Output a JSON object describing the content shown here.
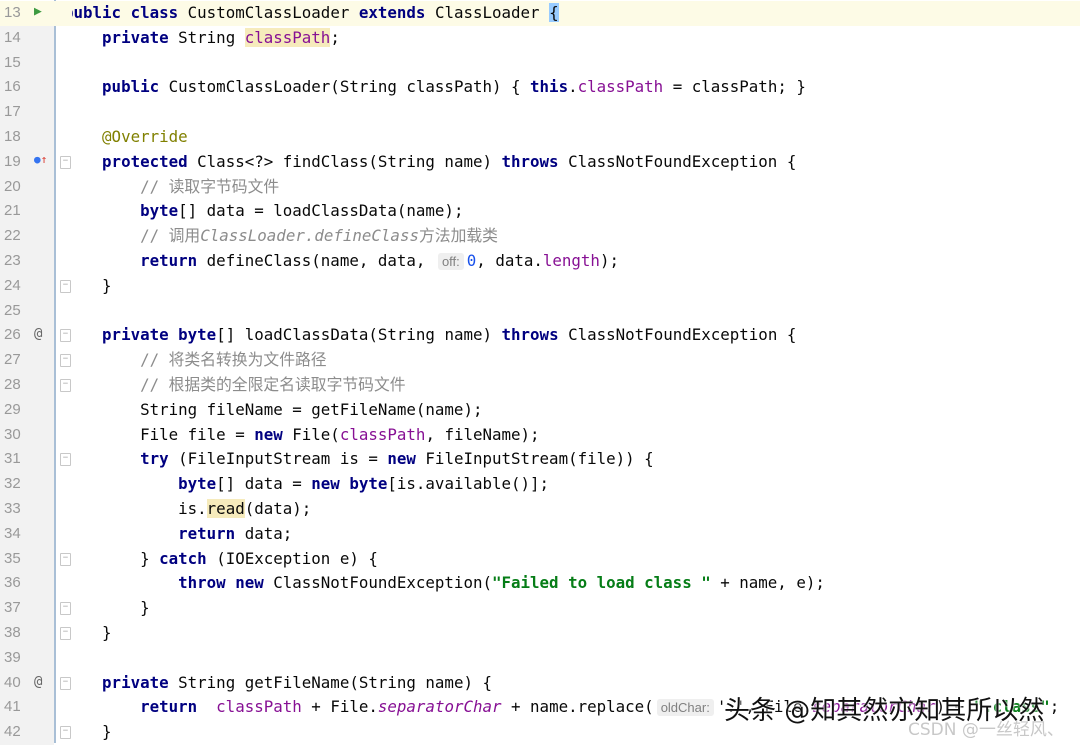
{
  "editor": {
    "current_line": 13,
    "lines": [
      {
        "n": "13",
        "icon": "run",
        "fold": "",
        "tokens": [
          [
            "public ",
            "kw"
          ],
          [
            "class ",
            "kw"
          ],
          [
            "CustomClassLoader ",
            ""
          ],
          [
            "extends ",
            "kw"
          ],
          [
            "ClassLoader ",
            ""
          ],
          [
            "{",
            "brace"
          ]
        ]
      },
      {
        "n": "14",
        "icon": "",
        "fold": "",
        "tokens": [
          [
            "    private ",
            "kw"
          ],
          [
            "String ",
            ""
          ],
          [
            "classPath",
            "fld hl"
          ],
          [
            ";",
            ""
          ]
        ]
      },
      {
        "n": "15",
        "icon": "",
        "fold": "",
        "tokens": []
      },
      {
        "n": "16",
        "icon": "",
        "fold": "",
        "tokens": [
          [
            "    public ",
            "kw"
          ],
          [
            "CustomClassLoader(String classPath) { ",
            ""
          ],
          [
            "this",
            "kw"
          ],
          [
            ".",
            ""
          ],
          [
            "classPath",
            "fld"
          ],
          [
            " = classPath; }",
            ""
          ]
        ]
      },
      {
        "n": "17",
        "icon": "",
        "fold": "",
        "tokens": []
      },
      {
        "n": "18",
        "icon": "",
        "fold": "",
        "tokens": [
          [
            "    @Override",
            "ann"
          ]
        ]
      },
      {
        "n": "19",
        "icon": "override",
        "fold": "open",
        "tokens": [
          [
            "    protected ",
            "kw"
          ],
          [
            "Class<?> findClass(String name) ",
            ""
          ],
          [
            "throws ",
            "kw"
          ],
          [
            "ClassNotFoundException {",
            ""
          ]
        ]
      },
      {
        "n": "20",
        "icon": "",
        "fold": "",
        "tokens": [
          [
            "        // 读取字节码文件",
            "cmt"
          ]
        ]
      },
      {
        "n": "21",
        "icon": "",
        "fold": "",
        "tokens": [
          [
            "        byte",
            "kw"
          ],
          [
            "[] data = loadClassData(name);",
            ""
          ]
        ]
      },
      {
        "n": "22",
        "icon": "",
        "fold": "",
        "tokens": [
          [
            "        // 调用",
            "cmt"
          ],
          [
            "ClassLoader.defineClass",
            "cmti"
          ],
          [
            "方法加载类",
            "cmt"
          ]
        ]
      },
      {
        "n": "23",
        "icon": "",
        "fold": "",
        "tokens": [
          [
            "        return ",
            "kw"
          ],
          [
            "defineClass(name, data, ",
            ""
          ],
          [
            "off:",
            "hint"
          ],
          [
            "0",
            "num"
          ],
          [
            ", data.",
            ""
          ],
          [
            "length",
            "fld"
          ],
          [
            ");",
            ""
          ]
        ]
      },
      {
        "n": "24",
        "icon": "",
        "fold": "close",
        "tokens": [
          [
            "    }",
            ""
          ]
        ]
      },
      {
        "n": "25",
        "icon": "",
        "fold": "",
        "tokens": []
      },
      {
        "n": "26",
        "icon": "at",
        "fold": "open",
        "tokens": [
          [
            "    private ",
            "kw"
          ],
          [
            "byte",
            "kw"
          ],
          [
            "[] loadClassData(String name) ",
            ""
          ],
          [
            "throws ",
            "kw"
          ],
          [
            "ClassNotFoundException {",
            ""
          ]
        ]
      },
      {
        "n": "27",
        "icon": "",
        "fold": "open",
        "tokens": [
          [
            "        // 将类名转换为文件路径",
            "cmt"
          ]
        ]
      },
      {
        "n": "28",
        "icon": "",
        "fold": "close",
        "tokens": [
          [
            "        // 根据类的全限定名读取字节码文件",
            "cmt"
          ]
        ]
      },
      {
        "n": "29",
        "icon": "",
        "fold": "",
        "tokens": [
          [
            "        String fileName = getFileName(name);",
            ""
          ]
        ]
      },
      {
        "n": "30",
        "icon": "",
        "fold": "",
        "tokens": [
          [
            "        File file = ",
            ""
          ],
          [
            "new ",
            "kw"
          ],
          [
            "File(",
            ""
          ],
          [
            "classPath",
            "fld"
          ],
          [
            ", fileName);",
            ""
          ]
        ]
      },
      {
        "n": "31",
        "icon": "",
        "fold": "open",
        "tokens": [
          [
            "        try ",
            "kw"
          ],
          [
            "(FileInputStream is = ",
            ""
          ],
          [
            "new ",
            "kw"
          ],
          [
            "FileInputStream(file)) {",
            ""
          ]
        ]
      },
      {
        "n": "32",
        "icon": "",
        "fold": "",
        "tokens": [
          [
            "            byte",
            "kw"
          ],
          [
            "[] data = ",
            ""
          ],
          [
            "new ",
            "kw"
          ],
          [
            "byte",
            "kw"
          ],
          [
            "[is.available()];",
            ""
          ]
        ]
      },
      {
        "n": "33",
        "icon": "",
        "fold": "",
        "tokens": [
          [
            "            is.",
            ""
          ],
          [
            "read",
            "hl"
          ],
          [
            "(data);",
            ""
          ]
        ]
      },
      {
        "n": "34",
        "icon": "",
        "fold": "",
        "tokens": [
          [
            "            return ",
            "kw"
          ],
          [
            "data;",
            ""
          ]
        ]
      },
      {
        "n": "35",
        "icon": "",
        "fold": "close",
        "tokens": [
          [
            "        } ",
            ""
          ],
          [
            "catch ",
            "kw"
          ],
          [
            "(IOException e) {",
            ""
          ]
        ]
      },
      {
        "n": "36",
        "icon": "",
        "fold": "",
        "tokens": [
          [
            "            throw new ",
            "kw"
          ],
          [
            "ClassNotFoundException(",
            ""
          ],
          [
            "\"Failed to load class \"",
            "str"
          ],
          [
            " + name, e);",
            ""
          ]
        ]
      },
      {
        "n": "37",
        "icon": "",
        "fold": "close",
        "tokens": [
          [
            "        }",
            ""
          ]
        ]
      },
      {
        "n": "38",
        "icon": "",
        "fold": "close",
        "tokens": [
          [
            "    }",
            ""
          ]
        ]
      },
      {
        "n": "39",
        "icon": "",
        "fold": "",
        "tokens": []
      },
      {
        "n": "40",
        "icon": "at",
        "fold": "open",
        "tokens": [
          [
            "    private ",
            "kw"
          ],
          [
            "String getFileName(String name) {",
            ""
          ]
        ]
      },
      {
        "n": "41",
        "icon": "",
        "fold": "",
        "tokens": [
          [
            "        return  ",
            "kw"
          ],
          [
            "classPath",
            "fld"
          ],
          [
            " + File.",
            ""
          ],
          [
            "separatorChar",
            "sfld"
          ],
          [
            " + name.replace(",
            ""
          ],
          [
            "oldChar:",
            "hint"
          ],
          [
            "'.', File.",
            ""
          ],
          [
            "separatorChar",
            "sfld"
          ],
          [
            ") + ",
            ""
          ],
          [
            "\".class\"",
            "str"
          ],
          [
            ";",
            ""
          ]
        ]
      },
      {
        "n": "42",
        "icon": "",
        "fold": "close",
        "tokens": [
          [
            "    }",
            ""
          ]
        ]
      }
    ]
  },
  "watermarks": {
    "toutiao": "头条 @知其然亦知其所以然",
    "csdn": "CSDN @一丝轻风、"
  }
}
